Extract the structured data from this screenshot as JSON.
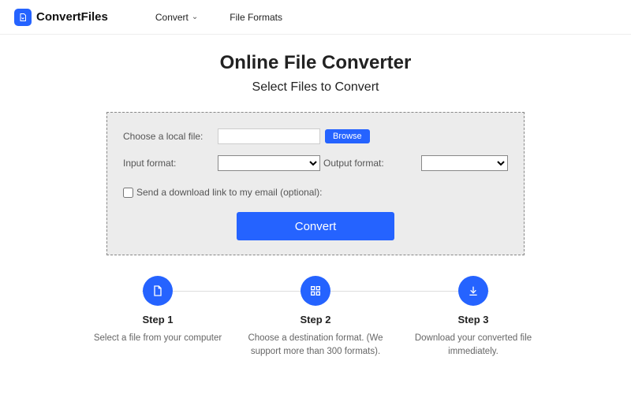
{
  "brand": {
    "name": "ConvertFiles"
  },
  "nav": {
    "convert": "Convert",
    "formats": "File Formats"
  },
  "hero": {
    "title": "Online File Converter",
    "subtitle": "Select Files to Convert"
  },
  "panel": {
    "choose_label": "Choose a local file:",
    "browse": "Browse",
    "input_format_label": "Input format:",
    "output_format_label": "Output format:",
    "email_label": "Send a download link to my email (optional):",
    "convert": "Convert"
  },
  "steps": [
    {
      "title": "Step 1",
      "desc": "Select a file from your computer"
    },
    {
      "title": "Step 2",
      "desc": "Choose a destination format. (We support more than 300 formats)."
    },
    {
      "title": "Step 3",
      "desc": "Download your converted file immediately."
    }
  ]
}
